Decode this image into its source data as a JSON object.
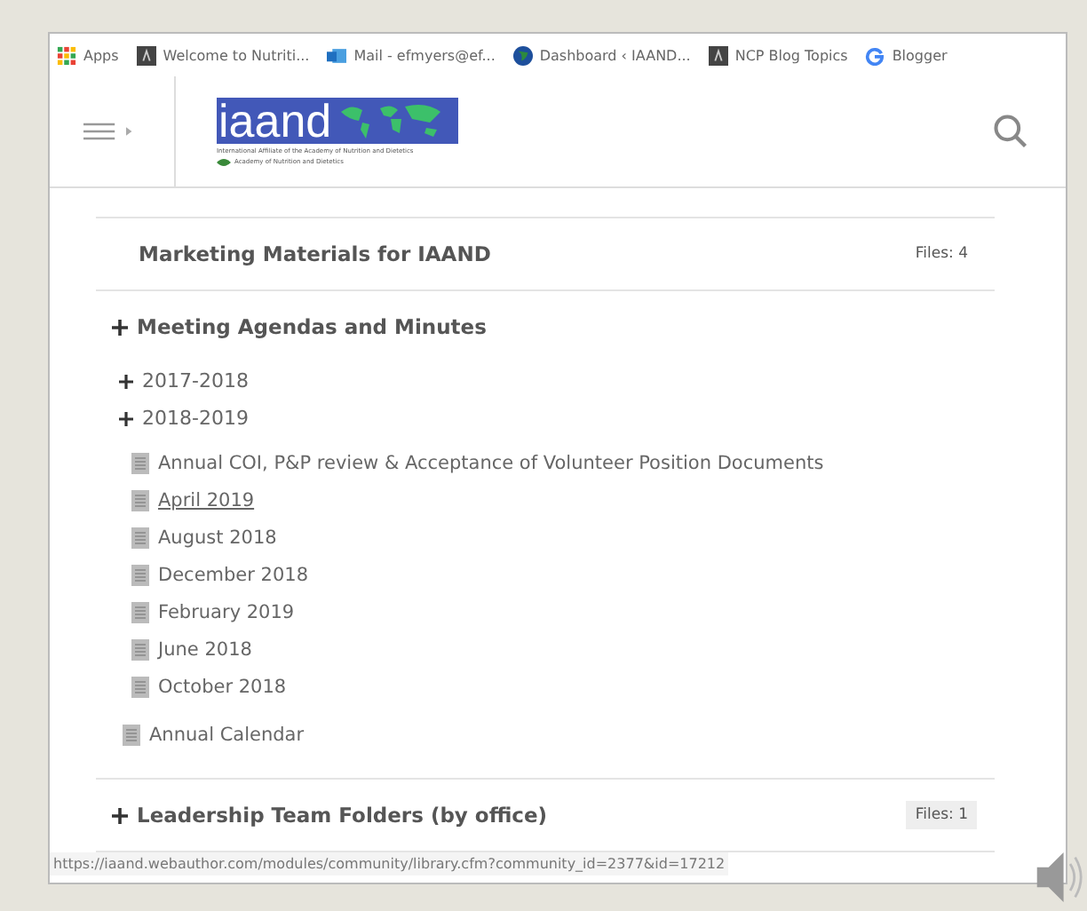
{
  "bookmarks": [
    {
      "kind": "apps",
      "label": "Apps"
    },
    {
      "kind": "page",
      "label": "Welcome to Nutriti..."
    },
    {
      "kind": "mail",
      "label": "Mail - efmyers@ef..."
    },
    {
      "kind": "globe",
      "label": "Dashboard ‹ IAAND..."
    },
    {
      "kind": "page",
      "label": "NCP Blog Topics"
    },
    {
      "kind": "google",
      "label": "Blogger"
    }
  ],
  "header": {
    "logo": {
      "wordmark": "iaand",
      "tagline": "International Affiliate of the Academy of Nutrition and Dietetics",
      "sub": "Academy of Nutrition and Dietetics"
    }
  },
  "sections": [
    {
      "title": "Marketing Materials for IAAND",
      "expandable": false,
      "files": "Files: 4",
      "files_boxed": false
    },
    {
      "title": "Meeting Agendas and Minutes",
      "expandable": true,
      "children": [
        {
          "kind": "folder",
          "label": "2017-2018"
        },
        {
          "kind": "folder",
          "label": "2018-2019",
          "children": [
            {
              "kind": "file",
              "label": "Annual COI, P&P review & Acceptance of Volunteer Position Documents",
              "hovered": false
            },
            {
              "kind": "file",
              "label": "April 2019",
              "hovered": true
            },
            {
              "kind": "file",
              "label": "August 2018",
              "hovered": false
            },
            {
              "kind": "file",
              "label": "December 2018",
              "hovered": false
            },
            {
              "kind": "file",
              "label": "February 2019",
              "hovered": false
            },
            {
              "kind": "file",
              "label": "June 2018",
              "hovered": false
            },
            {
              "kind": "file",
              "label": "October 2018",
              "hovered": false
            }
          ]
        },
        {
          "kind": "file",
          "label": "Annual Calendar",
          "hovered": false
        }
      ]
    },
    {
      "title": "Leadership Team Folders (by office)",
      "expandable": true,
      "files": "Files: 1",
      "files_boxed": true
    }
  ],
  "status_bar": {
    "url": "https://iaand.webauthor.com/modules/community/library.cfm?community_id=2377&id=17212"
  }
}
